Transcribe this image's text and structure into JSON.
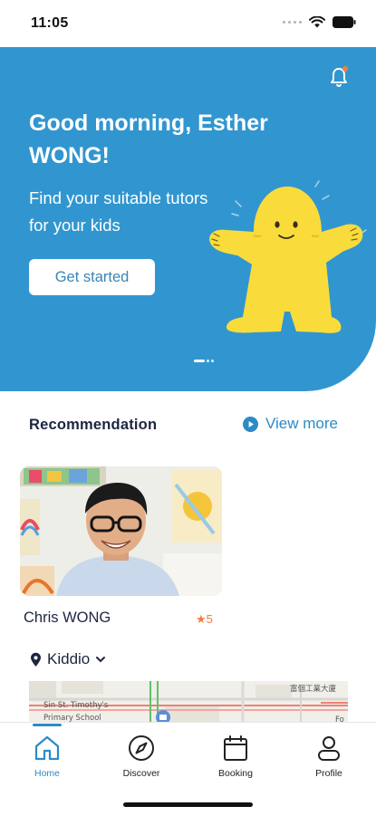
{
  "status_bar": {
    "time": "11:05"
  },
  "hero": {
    "greeting": "Good morning, Esther WONG!",
    "subtitle": "Find your suitable tutors for your kids",
    "cta_label": "Get started"
  },
  "recommendation": {
    "title": "Recommendation",
    "view_more_label": "View more",
    "tutors": [
      {
        "name": "Chris WONG",
        "rating": "★5"
      }
    ]
  },
  "location": {
    "label": "Kiddio"
  },
  "map": {
    "labels": [
      "Sin St. Timothy's",
      "Primary School",
      "富個工業大廈",
      "Fo"
    ]
  },
  "tab_bar": {
    "items": [
      {
        "label": "Home",
        "icon": "home-icon",
        "active": true
      },
      {
        "label": "Discover",
        "icon": "compass-icon",
        "active": false
      },
      {
        "label": "Booking",
        "icon": "calendar-icon",
        "active": false
      },
      {
        "label": "Profile",
        "icon": "person-icon",
        "active": false
      }
    ]
  },
  "colors": {
    "brand_blue": "#3196cf",
    "accent_blue": "#2b8bc6",
    "rating_orange": "#f0803c",
    "mascot_yellow": "#f9dc3c"
  }
}
